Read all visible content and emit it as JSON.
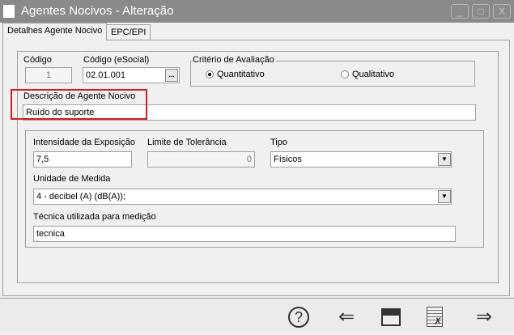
{
  "window": {
    "title": "Agentes Nocivos - Alteração",
    "min": "_",
    "max": "□",
    "close": "X"
  },
  "tabs": [
    "Detalhes Agente Nocivo",
    "EPC/EPI"
  ],
  "form": {
    "codigo_label": "Código",
    "codigo": "1",
    "esocial_label": "Código (eSocial)",
    "esocial": "02.01.001",
    "lookup": "...",
    "criterio_label": "Critério de Avaliação",
    "quantitativo": "Quantitativo",
    "qualitativo": "Qualitativo",
    "descricao_label": "Descrição de Agente Nocivo",
    "descricao": "Ruído do suporte",
    "intensidade_label": "Intensidade da Exposição",
    "intensidade": "7,5",
    "limite_label": "Limite de Tolerância",
    "limite": "0",
    "tipo_label": "Tipo",
    "tipo": "Físicos",
    "unidade_label": "Unidade de Medida",
    "unidade": "4 - decibel (A) (dB(A));",
    "tecnica_label": "Técnica utilizada para medição",
    "tecnica": "tecnica"
  },
  "toolbar": {
    "help": "?",
    "back": "⇐",
    "save": "💾",
    "cancel": "✗",
    "next": "⇒"
  },
  "highlight_color": "#e0191f"
}
